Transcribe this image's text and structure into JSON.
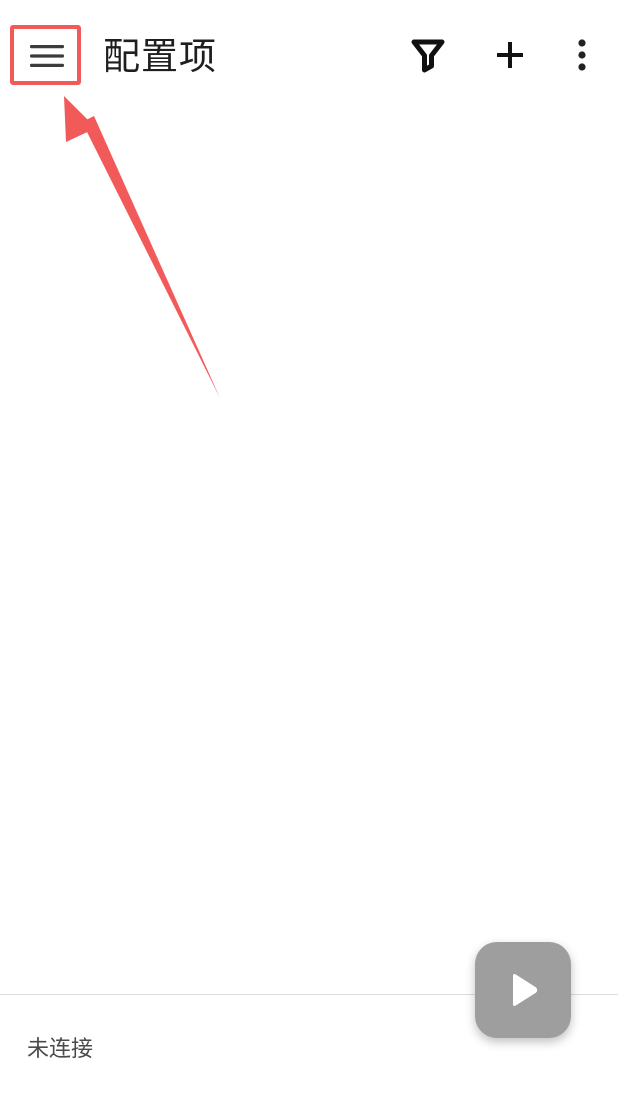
{
  "app_bar": {
    "title": "配置项",
    "icons": {
      "menu": "menu-icon",
      "filter": "filter-icon",
      "add": "plus-icon",
      "more": "more-vertical-icon"
    }
  },
  "fab": {
    "icon": "play-icon",
    "color": "#9e9e9e"
  },
  "status": {
    "text": "未连接"
  },
  "annotation": {
    "color": "#f25a5a"
  }
}
